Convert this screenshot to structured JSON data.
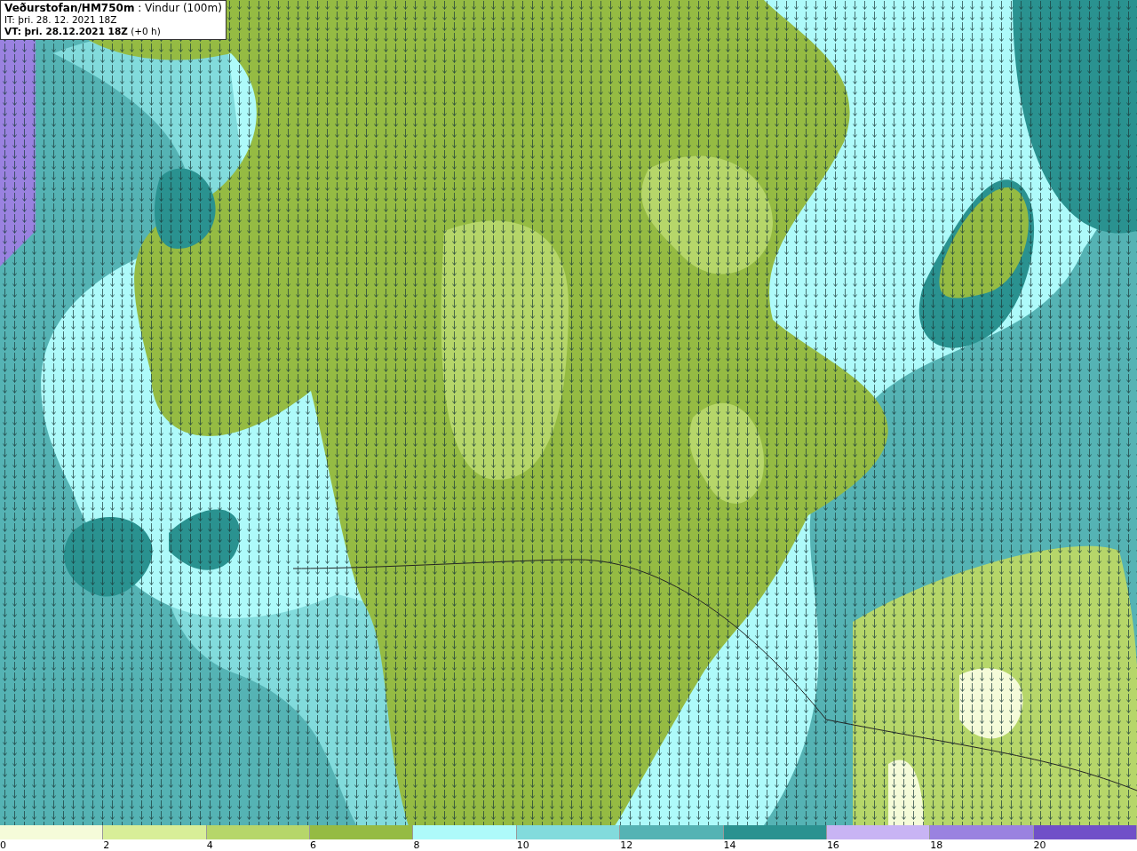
{
  "title_box": {
    "lines": [
      "**Veðurstofan/HM750m** : Vindur (100m)",
      "IT: þri. 28. 12. 2021 18Z",
      "**VT: þri. 28.12.2021 18Z** (+0 h)"
    ]
  },
  "legend": {
    "segments": [
      {
        "color": "#f5fbd9"
      },
      {
        "color": "#d8ee98"
      },
      {
        "color": "#b6d66a"
      },
      {
        "color": "#95bb43"
      },
      {
        "color": "#aefafa"
      },
      {
        "color": "#82dbdc"
      },
      {
        "color": "#55b3b4"
      },
      {
        "color": "#2a9290"
      },
      {
        "color": "#c8b4f4"
      },
      {
        "color": "#9a82e0"
      },
      {
        "color": "#7050c8"
      }
    ],
    "labels": [
      "0",
      "2",
      "4",
      "6",
      "8",
      "10",
      "12",
      "14",
      "16",
      "18",
      "20"
    ]
  }
}
